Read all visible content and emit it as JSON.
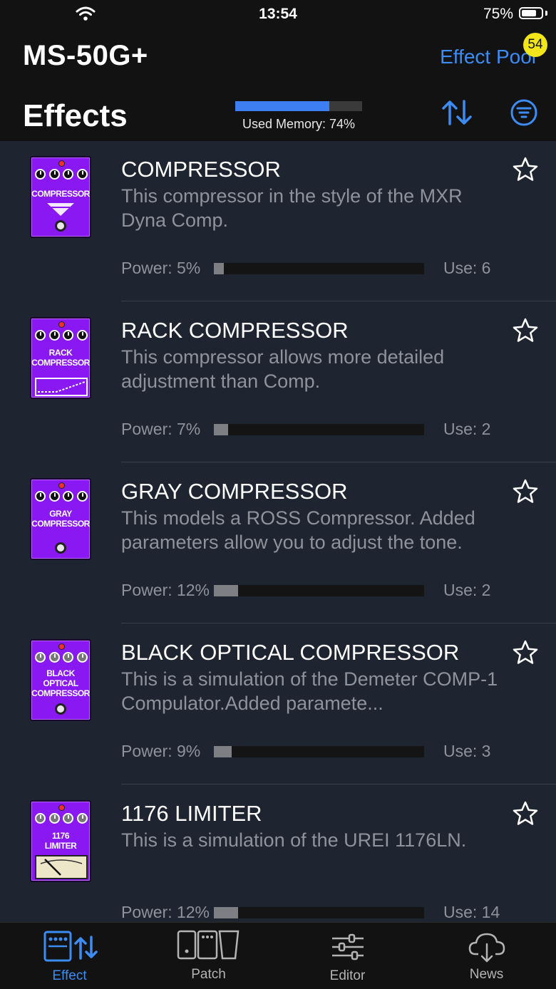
{
  "status_bar": {
    "time": "13:54",
    "battery_percent": "75%",
    "battery_level": 0.75
  },
  "header": {
    "app_title": "MS-50G+",
    "pool_link": "Effect Pool",
    "pool_badge": "54",
    "section_title": "Effects",
    "memory_label": "Used Memory: 74%",
    "memory_fraction": 0.74
  },
  "colors": {
    "accent": "#3d8cf3",
    "pedal": "#8918f2",
    "badge": "#f2e61b",
    "background": "#1f2530"
  },
  "effects": [
    {
      "name": "COMPRESSOR",
      "desc": "This compressor in the style of the MXR Dyna Comp.",
      "pedal_label": "COMPRESSOR",
      "power_label": "Power: 5%",
      "power": 0.05,
      "use": "Use: 6",
      "icon": "compressor-pedal-icon"
    },
    {
      "name": "RACK COMPRESSOR",
      "desc": "This compressor allows more detailed adjustment than Comp.",
      "pedal_label": "RACK\nCOMPRESSOR",
      "power_label": "Power: 7%",
      "power": 0.07,
      "use": "Use: 2",
      "icon": "rack-compressor-pedal-icon"
    },
    {
      "name": "GRAY COMPRESSOR",
      "desc": "This models a ROSS Compressor. Added parameters allow you to adjust the tone.",
      "pedal_label": "GRAY\nCOMPRESSOR",
      "power_label": "Power: 12%",
      "power": 0.12,
      "use": "Use: 2",
      "icon": "gray-compressor-pedal-icon"
    },
    {
      "name": "BLACK OPTICAL COMPRESSOR",
      "desc": "This is a simulation of the Demeter COMP-1 Compulator.Added paramete...",
      "pedal_label": "BLACK\nOPTICAL\nCOMPRESSOR",
      "power_label": "Power: 9%",
      "power": 0.09,
      "use": "Use: 3",
      "icon": "black-optical-compressor-pedal-icon"
    },
    {
      "name": "1176 LIMITER",
      "desc": "This is a simulation of the UREI 1176LN.",
      "pedal_label": "1176\nLIMITER",
      "power_label": "Power: 12%",
      "power": 0.12,
      "use": "Use: 14",
      "icon": "limiter-pedal-icon"
    }
  ],
  "tabs": [
    {
      "label": "Effect",
      "icon": "effect-tab-icon",
      "active": true
    },
    {
      "label": "Patch",
      "icon": "patch-tab-icon",
      "active": false
    },
    {
      "label": "Editor",
      "icon": "editor-sliders-icon",
      "active": false
    },
    {
      "label": "News",
      "icon": "cloud-download-icon",
      "active": false
    }
  ]
}
